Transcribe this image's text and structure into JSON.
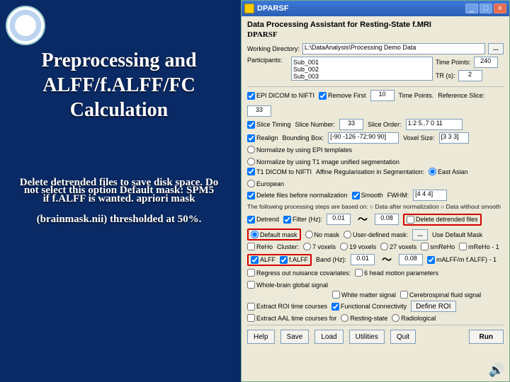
{
  "slide": {
    "title": "Preprocessing and ALFF/f.ALFF/FC Calculation",
    "note_line1": "Delete detrended files to save disk space. Do",
    "note_line2": "not select this option Default mask: SPM5",
    "note_line3": "if f.ALFF is wanted. apriori mask",
    "note_line4": "(brainmask.nii) thresholded at 50%."
  },
  "titlebar": {
    "label": "DPARSF",
    "min": "_",
    "max": "□",
    "close": "×"
  },
  "header": {
    "title": "Data Processing Assistant for Resting-State f.MRI",
    "subtitle": "DPARSF"
  },
  "workdir": {
    "label": "Working Directory:",
    "value": "L:\\DataAnalysis\\Processing Demo Data",
    "browse": "..."
  },
  "participants": {
    "label": "Participants:",
    "list": [
      "Sub_001",
      "Sub_002",
      "Sub_003"
    ],
    "tp_lbl": "Time Points:",
    "tp": "240",
    "tr_lbl": "TR (s):",
    "tr": "2"
  },
  "row1": {
    "epi": "EPI DICOM to NIFTI",
    "rem": "Remove First",
    "rem_n": "10",
    "tp_lbl": "Time Points.",
    "ref_lbl": "Reference Slice:",
    "ref": "33"
  },
  "row2": {
    "slice": "Slice Timing",
    "sn_lbl": "Slice Number:",
    "sn": "33",
    "so_lbl": "Slice Order:",
    "so": "1:2 5..7 0 11"
  },
  "row3": {
    "realign": "Realign",
    "bb_lbl": "Bounding Box:",
    "bb": "[-90 -126 -72;90 90]",
    "vox_lbl": "Voxel Size:",
    "vox": "[3 3 3]"
  },
  "row4": {
    "a": "Normalize by using EPI templates",
    "b": "Normalize by using T1 image unified segmentation"
  },
  "row5": {
    "t1": "T1 DICOM to NIFTI",
    "aff_lbl": "Affine Regularisation in Segmentation:",
    "optA": "East Asian",
    "optB": "European"
  },
  "row6": {
    "db": "Delete files before normalization",
    "sm": "Smooth",
    "fwhm_lbl": "FWHM:",
    "fwhm": "[4 4 4]"
  },
  "note": "The following processing steps are based on:   ○ Data after normalization   ○ Data without smooth",
  "row7": {
    "det": "Detrend",
    "flt": "Filter (Hz):",
    "lo": "0.01",
    "hi": "0.08",
    "del": "Delete detrended files"
  },
  "row8": {
    "def": "Default mask",
    "nom": "No mask",
    "user": "User-defined mask:",
    "browse": "...",
    "usedef": "Use Default Mask"
  },
  "row9": {
    "reho": "ReHo",
    "cl": "Cluster:",
    "a": "7 voxels",
    "b": "19 voxels",
    "c": "27 voxels",
    "sm": "smReHo",
    "m1": "mReHo - 1"
  },
  "row10": {
    "alff": "ALFF",
    "falff": "f.ALFF",
    "band_lbl": "Band (Hz):",
    "lo": "0.01",
    "hi": "0.08",
    "malff": "mALFF/m f.ALFF) - 1"
  },
  "row11": {
    "reg": "Regress out nuisance covariates:",
    "hm": "6 head motion parameters",
    "gs": "Whole-brain global signal"
  },
  "row12": {
    "wm": "White matter signal",
    "csf": "Cerebrospinal fluid signal"
  },
  "row13": {
    "roi": "Extract ROI time courses",
    "fc": "Functional Connectivity",
    "def": "Define ROI"
  },
  "row14": {
    "aal": "Extract AAL time courses for",
    "rest": "Resting-state",
    "ra": "Radiological"
  },
  "buttons": {
    "help": "Help",
    "save": "Save",
    "load": "Load",
    "util": "Utilities",
    "quit": "Quit",
    "run": "Run"
  }
}
